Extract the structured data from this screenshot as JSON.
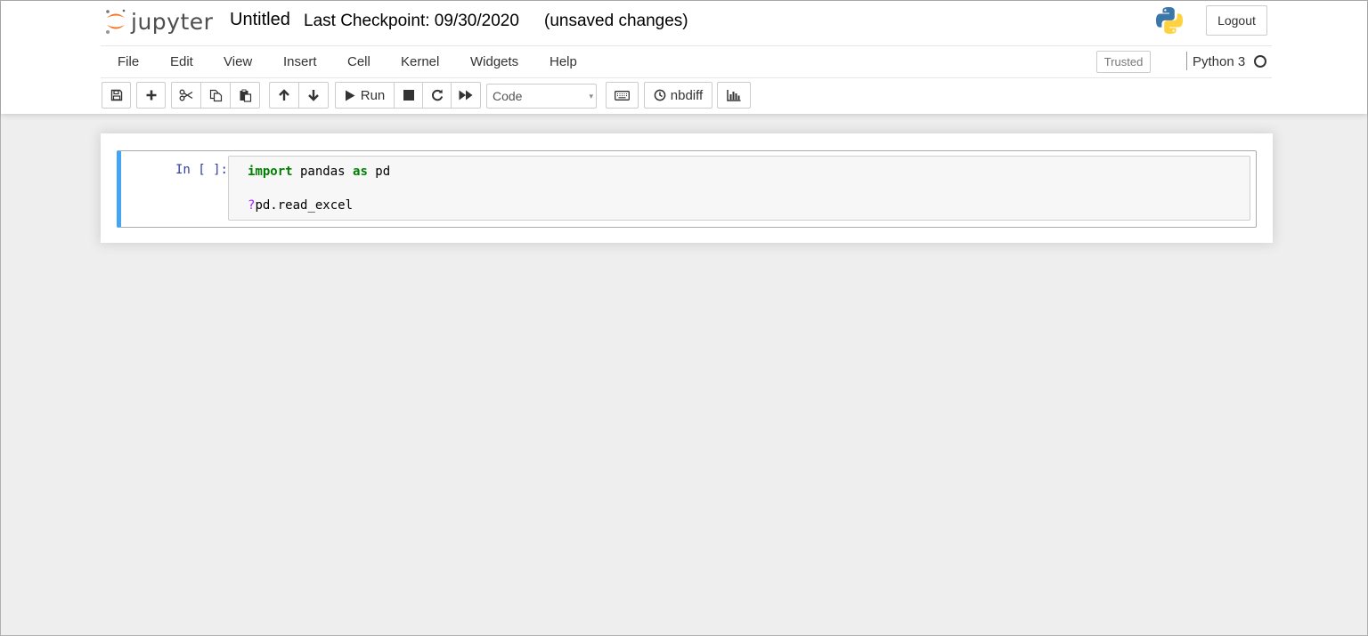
{
  "header": {
    "logo_text": "jupyter",
    "notebook_name": "Untitled",
    "checkpoint": "Last Checkpoint: 09/30/2020",
    "save_status": "(unsaved changes)",
    "logout_label": "Logout"
  },
  "menu": {
    "items": [
      "File",
      "Edit",
      "View",
      "Insert",
      "Cell",
      "Kernel",
      "Widgets",
      "Help"
    ],
    "trusted_label": "Trusted",
    "kernel_name": "Python 3"
  },
  "toolbar": {
    "run_label": "Run",
    "cell_type": "Code",
    "nbdiff_label": "nbdiff",
    "icons": [
      "save-icon",
      "plus-icon",
      "cut-icon",
      "copy-icon",
      "paste-icon",
      "arrow-up-icon",
      "arrow-down-icon",
      "play-icon",
      "stop-icon",
      "restart-icon",
      "fast-forward-icon",
      "keyboard-icon",
      "history-icon",
      "bar-chart-icon"
    ]
  },
  "cell": {
    "prompt": "In [ ]:",
    "code": {
      "line1": {
        "kw1": "import",
        "mid": " pandas ",
        "kw2": "as",
        "end": " pd"
      },
      "line2": {
        "op": "?",
        "rest": "pd.read_excel"
      }
    }
  },
  "colors": {
    "selected_cell_border": "#42a5f5",
    "prompt": "#303f9f",
    "keyword": "#008000",
    "operator": "#aa22ff",
    "jupyter_orange": "#f37626"
  }
}
